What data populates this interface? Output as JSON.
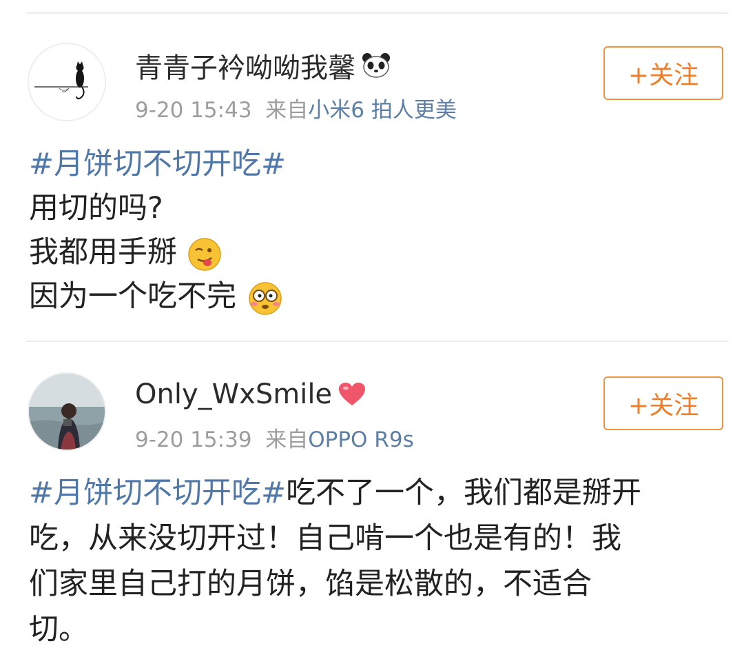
{
  "posts": [
    {
      "username": "青青子衿呦呦我馨",
      "username_emoji": "panda-emoji",
      "date": "9-20 15:43",
      "via_prefix": "来自",
      "source": "小米6 拍人更美",
      "follow_label": "+关注",
      "hashtag": "#月饼切不切开吃#",
      "lines": [
        "用切的吗?",
        "我都用手掰",
        "因为一个吃不完"
      ],
      "line_emojis": [
        "",
        "tongue-out-emoji",
        "flustered-emoji"
      ]
    },
    {
      "username": "Only_WxSmile",
      "username_emoji": "heart-emoji",
      "date": "9-20 15:39",
      "via_prefix": "来自",
      "source": "OPPO R9s",
      "follow_label": "+关注",
      "hashtag": "#月饼切不切开吃#",
      "hashtag_tail": "吃不了一个，我们都是掰开",
      "lines": [
        "吃，从来没切开过！自己啃一个也是有的！我",
        "们家里自己打的月饼，馅是松散的，不适合",
        "切。"
      ]
    }
  ],
  "colors": {
    "link_blue": "#4f77a8",
    "follow_orange": "#ee7e2a",
    "meta_gray": "#9d9d9d"
  }
}
